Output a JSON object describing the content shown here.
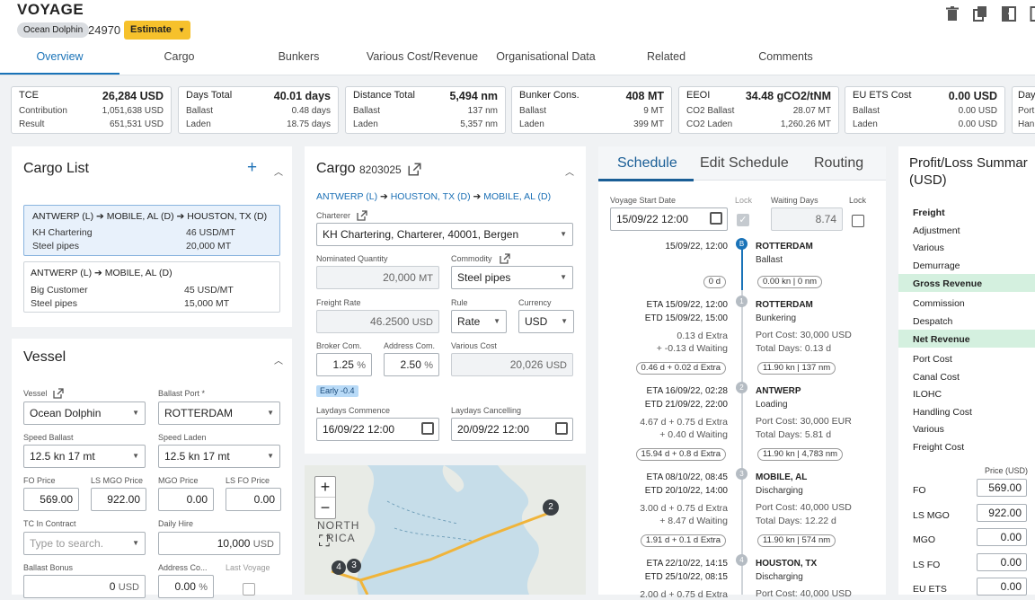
{
  "header": {
    "title": "VOYAGE",
    "vessel_chip": "Ocean Dolphin",
    "voyage_number": "24970",
    "status": "Estimate"
  },
  "tabs": [
    "Overview",
    "Cargo",
    "Bunkers",
    "Various Cost/Revenue",
    "Organisational Data",
    "Related",
    "Comments"
  ],
  "kpis": [
    {
      "main_label": "TCE",
      "main_value": "26,284 USD",
      "row1_label": "Contribution",
      "row1_value": "1,051,638 USD",
      "row2_label": "Result",
      "row2_value": "651,531 USD"
    },
    {
      "main_label": "Days Total",
      "main_value": "40.01 days",
      "row1_label": "Ballast",
      "row1_value": "0.48 days",
      "row2_label": "Laden",
      "row2_value": "18.75 days"
    },
    {
      "main_label": "Distance Total",
      "main_value": "5,494 nm",
      "row1_label": "Ballast",
      "row1_value": "137 nm",
      "row2_label": "Laden",
      "row2_value": "5,357 nm"
    },
    {
      "main_label": "Bunker Cons.",
      "main_value": "408 MT",
      "row1_label": "Ballast",
      "row1_value": "9 MT",
      "row2_label": "Laden",
      "row2_value": "399 MT"
    },
    {
      "main_label": "EEOI",
      "main_value": "34.48 gCO2/tNM",
      "row1_label": "CO2 Ballast",
      "row1_value": "28.07 MT",
      "row2_label": "CO2 Laden",
      "row2_value": "1,260.26 MT"
    },
    {
      "main_label": "EU ETS Cost",
      "main_value": "0.00 USD",
      "row1_label": "Ballast",
      "row1_value": "0.00 USD",
      "row2_label": "Laden",
      "row2_value": "0.00 USD"
    },
    {
      "main_label": "Days",
      "main_value": "",
      "row1_label": "Port",
      "row1_value": "",
      "row2_label": "Han",
      "row2_value": ""
    }
  ],
  "cargo_list": {
    "title": "Cargo List",
    "items": [
      {
        "route": [
          "ANTWERP (L)",
          "MOBILE, AL (D)",
          "HOUSTON, TX (D)"
        ],
        "charterer": "KH Chartering",
        "rate": "46 USD/MT",
        "commodity": "Steel pipes",
        "qty": "20,000 MT"
      },
      {
        "route": [
          "ANTWERP (L)",
          "MOBILE, AL (D)"
        ],
        "charterer": "Big Customer",
        "rate": "45 USD/MT",
        "commodity": "Steel pipes",
        "qty": "15,000 MT"
      }
    ]
  },
  "vessel": {
    "title": "Vessel",
    "vessel_label": "Vessel",
    "vessel_value": "Ocean Dolphin",
    "ballast_port_label": "Ballast Port *",
    "ballast_port_value": "ROTTERDAM",
    "speed_ballast_label": "Speed Ballast",
    "speed_ballast_value": "12.5 kn 17 mt",
    "speed_laden_label": "Speed Laden",
    "speed_laden_value": "12.5 kn 17 mt",
    "fo_label": "FO Price",
    "fo_value": "569.00",
    "lsmgo_label": "LS MGO Price",
    "lsmgo_value": "922.00",
    "mgo_label": "MGO Price",
    "mgo_value": "0.00",
    "lsfo_label": "LS FO Price",
    "lsfo_value": "0.00",
    "tc_label": "TC In Contract",
    "tc_placeholder": "Type to search.",
    "daily_hire_label": "Daily Hire",
    "daily_hire_value": "10,000",
    "daily_hire_unit": "USD",
    "ballast_bonus_label": "Ballast Bonus",
    "ballast_bonus_value": "0",
    "ballast_bonus_unit": "USD",
    "address_label": "Address Co...",
    "address_value": "0.00",
    "address_unit": "%",
    "last_voyage_label": "Last Voyage"
  },
  "cargo_detail": {
    "title": "Cargo",
    "number": "8203025",
    "route": [
      "ANTWERP (L)",
      "HOUSTON, TX (D)",
      "MOBILE, AL (D)"
    ],
    "charterer_label": "Charterer",
    "charterer_value": "KH Chartering, Charterer, 40001, Bergen",
    "qty_label": "Nominated Quantity",
    "qty_value": "20,000",
    "qty_unit": "MT",
    "commodity_label": "Commodity",
    "commodity_value": "Steel pipes",
    "freight_rate_label": "Freight Rate",
    "freight_rate_value": "46.2500",
    "freight_rate_unit": "USD",
    "rule_label": "Rule",
    "rule_value": "Rate",
    "currency_label": "Currency",
    "currency_value": "USD",
    "broker_label": "Broker Com.",
    "broker_value": "1.25",
    "broker_unit": "%",
    "addr_label": "Address Com.",
    "addr_value": "2.50",
    "addr_unit": "%",
    "various_label": "Various Cost",
    "various_value": "20,026",
    "various_unit": "USD",
    "early_badge": "Early -0.4",
    "laycomm_label": "Laydays Commence",
    "laycomm_value": "16/09/22 12:00",
    "laycanc_label": "Laydays Cancelling",
    "laycanc_value": "20/09/22 12:00"
  },
  "map": {
    "label_north": "NORTH",
    "label_rica": "RICA",
    "marker_2": "2",
    "marker_3": "3",
    "marker_4": "4",
    "zoom_in": "+",
    "zoom_out": "−"
  },
  "schedule": {
    "tabs": [
      "Schedule",
      "Edit Schedule",
      "Routing"
    ],
    "start_label": "Voyage Start Date",
    "start_value": "15/09/22 12:00",
    "lock_label": "Lock",
    "waiting_label": "Waiting Days",
    "waiting_value": "8.74",
    "stops": [
      {
        "marker": "B",
        "time1": "15/09/22, 12:00",
        "time2": "",
        "port": "ROTTERDAM",
        "activity": "Ballast",
        "cost": "",
        "days": "",
        "extra1": "",
        "extra2": "",
        "pill_left": "0 d",
        "pill_right": "0.00 kn | 0 nm"
      },
      {
        "marker": "1",
        "time1": "ETA 15/09/22, 12:00",
        "time2": "ETD 15/09/22, 15:00",
        "port": "ROTTERDAM",
        "activity": "Bunkering",
        "cost": "Port Cost: 30,000 USD",
        "days": "Total Days: 0.13 d",
        "extra1": "0.13 d Extra",
        "extra2": "+ -0.13 d Waiting",
        "pill_left": "0.46 d + 0.02 d Extra",
        "pill_right": "11.90 kn | 137 nm"
      },
      {
        "marker": "2",
        "time1": "ETA 16/09/22, 02:28",
        "time2": "ETD 21/09/22, 22:00",
        "port": "ANTWERP",
        "activity": "Loading",
        "cost": "Port Cost: 30,000 EUR",
        "days": "Total Days: 5.81 d",
        "extra1": "4.67 d + 0.75 d Extra",
        "extra2": "+ 0.40 d Waiting",
        "pill_left": "15.94 d + 0.8 d Extra",
        "pill_right": "11.90 kn | 4,783 nm"
      },
      {
        "marker": "3",
        "time1": "ETA 08/10/22, 08:45",
        "time2": "ETD 20/10/22, 14:00",
        "port": "MOBILE, AL",
        "activity": "Discharging",
        "cost": "Port Cost: 40,000 USD",
        "days": "Total Days: 12.22 d",
        "extra1": "3.00 d + 0.75 d Extra",
        "extra2": "+ 8.47 d Waiting",
        "pill_left": "1.91 d + 0.1 d Extra",
        "pill_right": "11.90 kn | 574 nm"
      },
      {
        "marker": "4",
        "time1": "ETA 22/10/22, 14:15",
        "time2": "ETD 25/10/22, 08:15",
        "port": "HOUSTON, TX",
        "activity": "Discharging",
        "cost": "Port Cost: 40,000 USD",
        "days": "",
        "extra1": "2.00 d + 0.75 d Extra",
        "extra2": "",
        "pill_left": "",
        "pill_right": ""
      }
    ]
  },
  "pnl": {
    "title1": "Profit/Loss Summar",
    "title2": "(USD)",
    "rows": [
      "Freight",
      "Adjustment",
      "Various",
      "Demurrage",
      "Gross Revenue",
      "Commission",
      "Despatch",
      "Net Revenue",
      "Port Cost",
      "Canal Cost",
      "ILOHC",
      "Handling Cost",
      "Various",
      "Freight Cost"
    ],
    "price_header": "Price (USD)",
    "prices": [
      {
        "label": "FO",
        "value": "569.00"
      },
      {
        "label": "LS MGO",
        "value": "922.00"
      },
      {
        "label": "MGO",
        "value": "0.00"
      },
      {
        "label": "LS FO",
        "value": "0.00"
      },
      {
        "label": "EU ETS",
        "value": "0.00"
      }
    ]
  }
}
